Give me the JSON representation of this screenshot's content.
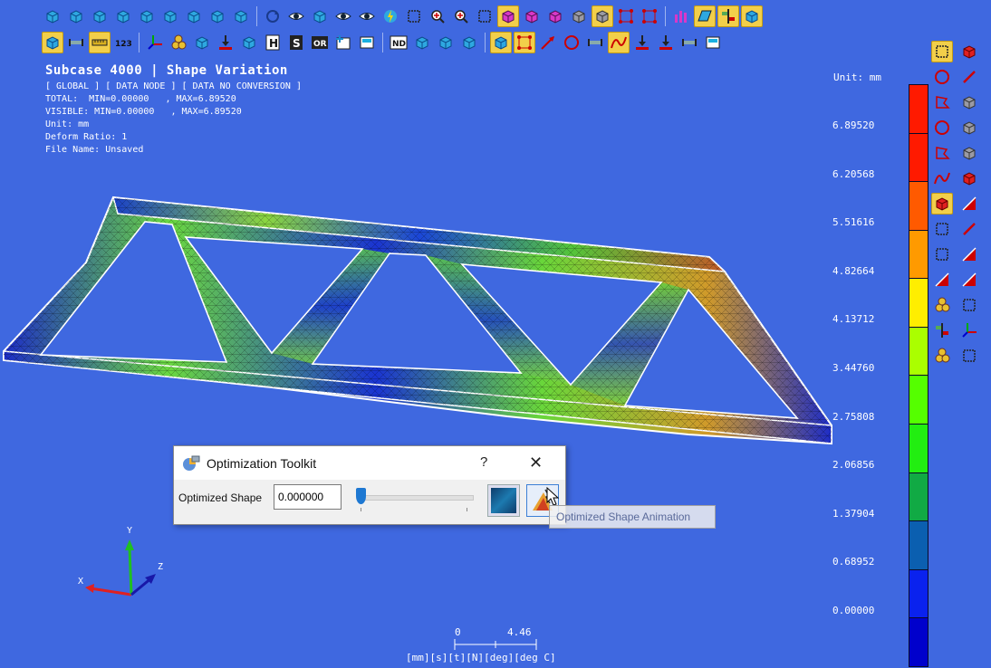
{
  "viewport": {
    "title": "Subcase 4000 | Shape Variation",
    "info_lines": [
      "[ GLOBAL ] [ DATA NODE ] [ DATA NO CONVERSION ]",
      "TOTAL:  MIN=0.00000   , MAX=6.89520",
      "VISIBLE: MIN=0.00000   , MAX=6.89520",
      "Unit: mm",
      "Deform Ratio: 1",
      "File Name: Unsaved"
    ]
  },
  "legend": {
    "unit_label": "Unit: mm",
    "ticks": [
      "6.89520",
      "6.20568",
      "5.51616",
      "4.82664",
      "4.13712",
      "3.44760",
      "2.75808",
      "2.06856",
      "1.37904",
      "0.68952",
      "0.00000"
    ],
    "colors": [
      "#ff1a00",
      "#ff1a00",
      "#ff5a00",
      "#ff9a00",
      "#ffee00",
      "#aaff00",
      "#55ff00",
      "#22ee11",
      "#11aa44",
      "#0b5fb0",
      "#0a22ee",
      "#0000cc"
    ]
  },
  "triad": {
    "x": "X",
    "y": "Y",
    "z": "Z"
  },
  "scale": {
    "left": "0",
    "right": "4.46",
    "units": "[mm][s][t][N][deg][deg C]"
  },
  "dialog": {
    "title": "Optimization Toolkit",
    "help": "?",
    "close": "✕",
    "field_label": "Optimized Shape",
    "field_value": "0.000000",
    "slider_fraction": 0,
    "tooltip": "Optimized Shape Animation"
  },
  "toolbar1": [
    {
      "icon": "iso-view-icon",
      "hl": false,
      "glyph": "cube"
    },
    {
      "icon": "front-view-icon",
      "hl": false,
      "glyph": "cube"
    },
    {
      "icon": "back-view-icon",
      "hl": false,
      "glyph": "cube"
    },
    {
      "icon": "left-view-icon",
      "hl": false,
      "glyph": "cube"
    },
    {
      "icon": "right-view-icon",
      "hl": false,
      "glyph": "cube"
    },
    {
      "icon": "top-view-icon",
      "hl": false,
      "glyph": "cube"
    },
    {
      "icon": "bottom-view-icon",
      "hl": false,
      "glyph": "cube"
    },
    {
      "icon": "user-view-1-icon",
      "hl": false,
      "glyph": "cube"
    },
    {
      "icon": "user-view-2-icon",
      "hl": false,
      "glyph": "cube"
    },
    {
      "icon": "sep"
    },
    {
      "icon": "rotate-icon",
      "hl": false,
      "glyph": "rot"
    },
    {
      "icon": "eye-rotate-icon",
      "hl": false,
      "glyph": "eye"
    },
    {
      "icon": "normal-view-icon",
      "hl": false,
      "glyph": "cube"
    },
    {
      "icon": "view-eye-icon",
      "hl": false,
      "glyph": "eye"
    },
    {
      "icon": "pan-icon",
      "hl": false,
      "glyph": "eye"
    },
    {
      "icon": "fit-icon",
      "hl": false,
      "glyph": "bolt"
    },
    {
      "icon": "zoom-box-icon",
      "hl": false,
      "glyph": "box"
    },
    {
      "icon": "zoom-in-icon",
      "hl": false,
      "glyph": "zoom"
    },
    {
      "icon": "zoom-out-icon",
      "hl": false,
      "glyph": "zoom"
    },
    {
      "icon": "zoom-select-icon",
      "hl": false,
      "glyph": "box"
    },
    {
      "icon": "shaded-mode-icon",
      "hl": true,
      "glyph": "pcube"
    },
    {
      "icon": "shaded-edge-icon",
      "hl": false,
      "glyph": "pcube"
    },
    {
      "icon": "wireframe-shade-icon",
      "hl": false,
      "glyph": "pcube"
    },
    {
      "icon": "transparent-icon",
      "hl": false,
      "glyph": "gcube"
    },
    {
      "icon": "hidden-line-icon",
      "hl": true,
      "glyph": "gcube"
    },
    {
      "icon": "node-display-icon",
      "hl": false,
      "glyph": "nodes"
    },
    {
      "icon": "node-edge-icon",
      "hl": false,
      "glyph": "nodes"
    },
    {
      "icon": "sep"
    },
    {
      "icon": "bar-chart-icon",
      "hl": false,
      "glyph": "bars"
    },
    {
      "icon": "plane-icon",
      "hl": true,
      "glyph": "plane"
    },
    {
      "icon": "align-icon",
      "hl": true,
      "glyph": "align"
    },
    {
      "icon": "transform-icon",
      "hl": true,
      "glyph": "cube"
    }
  ],
  "toolbar2": [
    {
      "icon": "solid-display-icon",
      "hl": true,
      "glyph": "cube"
    },
    {
      "icon": "beam-display-icon",
      "hl": false,
      "glyph": "beam"
    },
    {
      "icon": "ruler-icon",
      "hl": true,
      "glyph": "ruler"
    },
    {
      "icon": "numbering-icon",
      "hl": false,
      "glyph": "num"
    },
    {
      "icon": "sep"
    },
    {
      "icon": "coord-system-icon",
      "hl": false,
      "glyph": "coord"
    },
    {
      "icon": "element-group-icon",
      "hl": false,
      "glyph": "spheres"
    },
    {
      "icon": "element-shrink-icon",
      "hl": false,
      "glyph": "cube"
    },
    {
      "icon": "load-icon",
      "hl": false,
      "glyph": "load"
    },
    {
      "icon": "mass-icon",
      "hl": false,
      "glyph": "cube"
    },
    {
      "icon": "h-adapt-icon",
      "hl": false,
      "glyph": "H"
    },
    {
      "icon": "s-section-icon",
      "hl": false,
      "glyph": "S"
    },
    {
      "icon": "or-label-icon",
      "hl": false,
      "glyph": "OR"
    },
    {
      "icon": "plus-panel-icon",
      "hl": false,
      "glyph": "plus"
    },
    {
      "icon": "panel-icon",
      "hl": false,
      "glyph": "panel"
    },
    {
      "icon": "sep"
    },
    {
      "icon": "node-display-tool-icon",
      "hl": false,
      "glyph": "ND"
    },
    {
      "icon": "mesh-color-icon",
      "hl": false,
      "glyph": "cube"
    },
    {
      "icon": "element-color-icon",
      "hl": false,
      "glyph": "cube"
    },
    {
      "icon": "group-color-icon",
      "hl": false,
      "glyph": "cube"
    },
    {
      "icon": "sep"
    },
    {
      "icon": "contour-icon",
      "hl": true,
      "glyph": "cube"
    },
    {
      "icon": "node-cloud-icon",
      "hl": true,
      "glyph": "nodes"
    },
    {
      "icon": "vector-icon",
      "hl": false,
      "glyph": "arrow"
    },
    {
      "icon": "circle-icon",
      "hl": false,
      "glyph": "circle"
    },
    {
      "icon": "symbol-icon",
      "hl": false,
      "glyph": "beam"
    },
    {
      "icon": "curve-icon",
      "hl": true,
      "glyph": "curve"
    },
    {
      "icon": "bc-display-icon",
      "hl": false,
      "glyph": "load"
    },
    {
      "icon": "support-icon",
      "hl": false,
      "glyph": "load"
    },
    {
      "icon": "connect-icon",
      "hl": false,
      "glyph": "beam"
    },
    {
      "icon": "info-icon",
      "hl": false,
      "glyph": "panel"
    }
  ],
  "vtoolbar": [
    {
      "icon": "select-box-icon",
      "hl": true,
      "glyph": "box"
    },
    {
      "icon": "red-cube-icon",
      "hl": false,
      "glyph": "rcube"
    },
    {
      "icon": "select-circle-icon",
      "hl": false,
      "glyph": "circle"
    },
    {
      "icon": "select-line-icon",
      "hl": false,
      "glyph": "line"
    },
    {
      "icon": "select-polygon-icon",
      "hl": false,
      "glyph": "poly"
    },
    {
      "icon": "select-cube-face-icon",
      "hl": false,
      "glyph": "gcube"
    },
    {
      "icon": "select-ellipse-icon",
      "hl": false,
      "glyph": "circle"
    },
    {
      "icon": "select-cube-icon",
      "hl": false,
      "glyph": "gcube"
    },
    {
      "icon": "select-freehand-icon",
      "hl": false,
      "glyph": "poly"
    },
    {
      "icon": "select-cube-edge-icon",
      "hl": false,
      "glyph": "gcube"
    },
    {
      "icon": "select-arc-icon",
      "hl": false,
      "glyph": "curve"
    },
    {
      "icon": "select-mesh-icon",
      "hl": false,
      "glyph": "rcube"
    },
    {
      "icon": "select-window-icon",
      "hl": true,
      "glyph": "rcube"
    },
    {
      "icon": "select-tri-icon",
      "hl": false,
      "glyph": "tri"
    },
    {
      "icon": "select-node-icon",
      "hl": false,
      "glyph": "box"
    },
    {
      "icon": "select-red-line-icon",
      "hl": false,
      "glyph": "line"
    },
    {
      "icon": "select-overlap-icon",
      "hl": false,
      "glyph": "box"
    },
    {
      "icon": "select-slash-icon",
      "hl": false,
      "glyph": "tri"
    },
    {
      "icon": "select-pyramid-icon",
      "hl": false,
      "glyph": "tri"
    },
    {
      "icon": "select-slash-2-icon",
      "hl": false,
      "glyph": "tri"
    },
    {
      "icon": "select-spheres-icon",
      "hl": false,
      "glyph": "spheres"
    },
    {
      "icon": "select-diamond-icon",
      "hl": false,
      "glyph": "box"
    },
    {
      "icon": "select-align-icon",
      "hl": false,
      "glyph": "align"
    },
    {
      "icon": "select-coord-icon",
      "hl": false,
      "glyph": "coord"
    },
    {
      "icon": "select-yellow-spheres-icon",
      "hl": false,
      "glyph": "spheres"
    },
    {
      "icon": "select-clear-icon",
      "hl": false,
      "glyph": "box"
    }
  ]
}
